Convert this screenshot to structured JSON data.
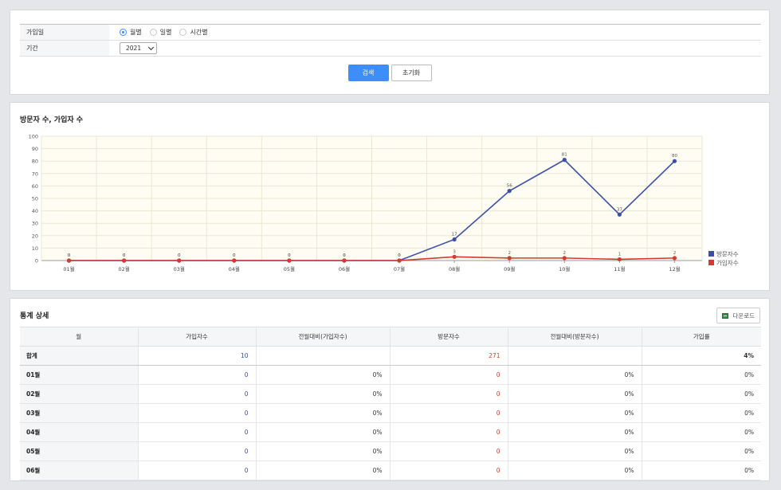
{
  "filter": {
    "join_date_label": "가입일",
    "period_label": "기간",
    "radios": [
      {
        "label": "월별",
        "checked": true
      },
      {
        "label": "일별",
        "checked": false
      },
      {
        "label": "시간별",
        "checked": false
      }
    ],
    "year_value": "2021",
    "search_label": "검색",
    "reset_label": "초기화"
  },
  "chart_section": {
    "title": "방문자 수, 가입자 수"
  },
  "chart_data": {
    "type": "line",
    "categories": [
      "01월",
      "02월",
      "03월",
      "04월",
      "05월",
      "06월",
      "07월",
      "08월",
      "09월",
      "10월",
      "11월",
      "12월"
    ],
    "series": [
      {
        "name": "방문자수",
        "color": "#3a4fa8",
        "values": [
          0,
          0,
          0,
          0,
          0,
          0,
          0,
          17,
          56,
          81,
          37,
          80
        ]
      },
      {
        "name": "가입자수",
        "color": "#d23b2e",
        "values": [
          0,
          0,
          0,
          0,
          0,
          0,
          0,
          3,
          2,
          2,
          1,
          2
        ]
      }
    ],
    "ylim": [
      0,
      100
    ],
    "yticks": [
      0,
      10,
      20,
      30,
      40,
      50,
      60,
      70,
      80,
      90,
      100
    ],
    "grid": true,
    "legend": "right",
    "plot_background": "#fffdf3"
  },
  "stats": {
    "title": "통계 상세",
    "download_label": "다운로드",
    "headers": [
      "월",
      "가입자수",
      "전월대비(가입자수)",
      "방문자수",
      "전월대비(방문자수)",
      "가입률"
    ],
    "total": {
      "month": "합계",
      "joins": "10",
      "joins_mom": "",
      "visits": "271",
      "visits_mom": "",
      "rate": "4%"
    },
    "rows": [
      {
        "month": "01월",
        "joins": "0",
        "joins_mom": "0%",
        "visits": "0",
        "visits_mom": "0%",
        "rate": "0%"
      },
      {
        "month": "02월",
        "joins": "0",
        "joins_mom": "0%",
        "visits": "0",
        "visits_mom": "0%",
        "rate": "0%"
      },
      {
        "month": "03월",
        "joins": "0",
        "joins_mom": "0%",
        "visits": "0",
        "visits_mom": "0%",
        "rate": "0%"
      },
      {
        "month": "04월",
        "joins": "0",
        "joins_mom": "0%",
        "visits": "0",
        "visits_mom": "0%",
        "rate": "0%"
      },
      {
        "month": "05월",
        "joins": "0",
        "joins_mom": "0%",
        "visits": "0",
        "visits_mom": "0%",
        "rate": "0%"
      },
      {
        "month": "06월",
        "joins": "0",
        "joins_mom": "0%",
        "visits": "0",
        "visits_mom": "0%",
        "rate": "0%"
      }
    ]
  }
}
